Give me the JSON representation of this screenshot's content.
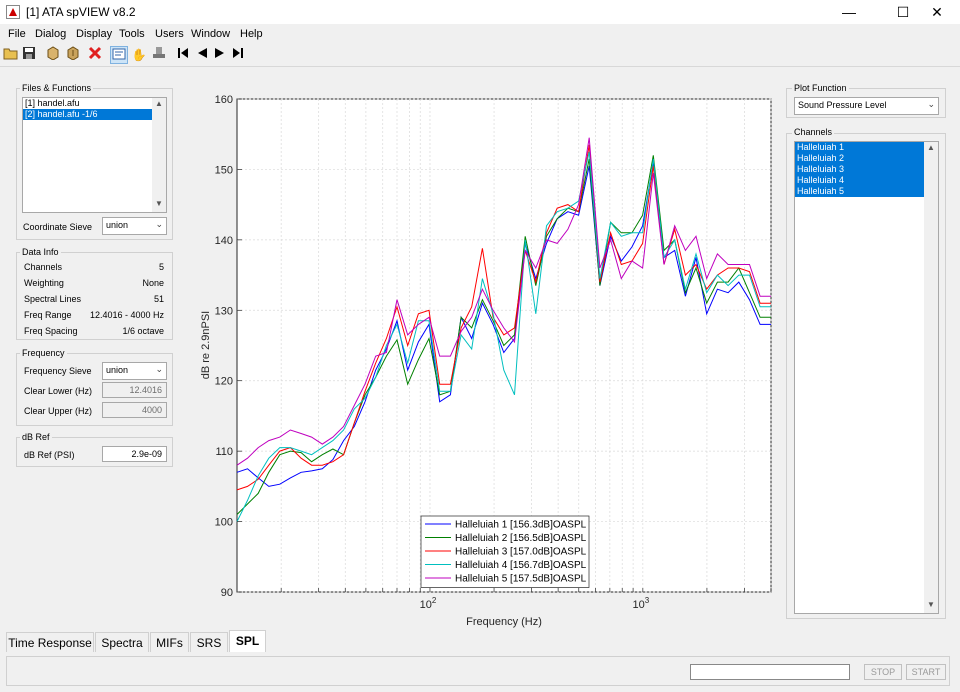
{
  "window": {
    "title": "[1] ATA spVIEW v8.2"
  },
  "menu": [
    "File",
    "Dialog",
    "Display",
    "Tools",
    "Users",
    "Window",
    "Help"
  ],
  "files_functions": {
    "title": "Files & Functions",
    "items": [
      {
        "label": "[1] handel.afu",
        "selected": false
      },
      {
        "label": "[2] handel.afu -1/6",
        "selected": true
      }
    ],
    "coordinate_sieve_label": "Coordinate Sieve",
    "coordinate_sieve_value": "union"
  },
  "data_info": {
    "title": "Data Info",
    "rows": [
      {
        "label": "Channels",
        "value": "5"
      },
      {
        "label": "Weighting",
        "value": "None"
      },
      {
        "label": "Spectral Lines",
        "value": "51"
      },
      {
        "label": "Freq Range",
        "value": "12.4016 - 4000 Hz"
      },
      {
        "label": "Freq Spacing",
        "value": "1/6 octave"
      }
    ]
  },
  "frequency": {
    "title": "Frequency",
    "sieve_label": "Frequency Sieve",
    "sieve_value": "union",
    "clear_lower_label": "Clear Lower (Hz)",
    "clear_lower_value": "12.4016",
    "clear_upper_label": "Clear Upper (Hz)",
    "clear_upper_value": "4000"
  },
  "db_ref": {
    "title": "dB Ref",
    "label": "dB Ref (PSI)",
    "value": "2.9e-09"
  },
  "plot_function": {
    "title": "Plot Function",
    "value": "Sound Pressure Level"
  },
  "channels": {
    "title": "Channels",
    "items": [
      "Halleluiah 1",
      "Halleluiah 2",
      "Halleluiah 3",
      "Halleluiah 4",
      "Halleluiah 5"
    ]
  },
  "tabs": [
    {
      "label": "Time Response",
      "active": false
    },
    {
      "label": "Spectra",
      "active": false
    },
    {
      "label": "MIFs",
      "active": false
    },
    {
      "label": "SRS",
      "active": false
    },
    {
      "label": "SPL",
      "active": true
    }
  ],
  "buttons": {
    "stop": "STOP",
    "start": "START"
  },
  "chart_data": {
    "type": "line",
    "xlabel": "Frequency (Hz)",
    "ylabel": "dB re 2.9nPSI",
    "xscale": "log",
    "xlim": [
      12.4016,
      4000
    ],
    "ylim": [
      90,
      160
    ],
    "yticks": [
      90,
      100,
      110,
      120,
      130,
      140,
      150,
      160
    ],
    "xtick_labels": [
      {
        "value": 100,
        "base": "10",
        "exp": "2"
      },
      {
        "value": 1000,
        "base": "10",
        "exp": "3"
      }
    ],
    "grid": true,
    "legend_position": "bottom-center",
    "x": [
      12.4,
      13.9,
      15.6,
      17.5,
      19.7,
      22.1,
      24.8,
      27.8,
      31.2,
      35.0,
      39.3,
      44.1,
      49.5,
      55.6,
      62.4,
      70.0,
      78.6,
      88.2,
      99.0,
      111.1,
      124.7,
      140.0,
      157.1,
      176.4,
      198.0,
      222.2,
      249.4,
      280.0,
      314.3,
      352.8,
      396.0,
      444.5,
      498.9,
      560.0,
      628.6,
      705.6,
      792.0,
      889.0,
      997.9,
      1120.1,
      1257.3,
      1411.3,
      1584.1,
      1778.1,
      1995.9,
      2240.3,
      2514.7,
      2822.6,
      3168.3,
      3556.3,
      4000.0
    ],
    "series": [
      {
        "name": "Halleluiah 1 [156.3dB]OASPL",
        "color": "#0000ff",
        "values": [
          107.0,
          107.5,
          106.2,
          105.0,
          105.3,
          106.2,
          107.0,
          107.2,
          107.5,
          108.8,
          111.5,
          113.5,
          117.0,
          121.5,
          124.5,
          128.5,
          121.5,
          125.5,
          128.0,
          117.0,
          118.0,
          129.0,
          126.0,
          131.0,
          128.0,
          124.0,
          126.0,
          139.5,
          134.5,
          139.5,
          143.0,
          144.0,
          143.5,
          150.5,
          133.5,
          140.5,
          137.0,
          139.0,
          142.0,
          151.0,
          137.5,
          138.5,
          132.0,
          137.5,
          129.5,
          133.0,
          132.5,
          134.0,
          131.5,
          128.0,
          128.0
        ]
      },
      {
        "name": "Halleluiah 2 [156.5dB]OASPL",
        "color": "#008000",
        "values": [
          101.0,
          102.5,
          104.0,
          107.0,
          109.5,
          110.0,
          109.8,
          108.5,
          109.5,
          110.3,
          109.5,
          114.0,
          118.0,
          120.5,
          123.5,
          125.8,
          119.5,
          123.0,
          126.0,
          118.0,
          118.5,
          129.0,
          127.5,
          131.5,
          128.5,
          125.0,
          126.5,
          140.5,
          133.5,
          140.5,
          143.0,
          144.5,
          144.0,
          151.5,
          133.5,
          142.5,
          141.0,
          141.0,
          143.5,
          152.0,
          138.5,
          140.0,
          132.5,
          136.0,
          131.0,
          134.0,
          134.0,
          136.0,
          132.5,
          129.0,
          129.0
        ]
      },
      {
        "name": "Halleluiah 3 [157.0dB]OASPL",
        "color": "#ff0000",
        "values": [
          104.5,
          105.0,
          106.0,
          108.0,
          110.0,
          110.5,
          109.0,
          108.0,
          108.0,
          108.5,
          109.5,
          114.0,
          118.5,
          122.5,
          126.0,
          130.5,
          125.0,
          129.5,
          130.0,
          119.5,
          119.5,
          127.5,
          130.5,
          138.8,
          129.0,
          126.5,
          127.5,
          138.5,
          134.0,
          141.0,
          144.5,
          145.0,
          144.0,
          153.5,
          134.0,
          141.0,
          136.5,
          137.0,
          139.5,
          150.5,
          136.5,
          141.5,
          135.0,
          136.5,
          133.0,
          135.0,
          136.0,
          136.0,
          135.5,
          131.0,
          131.0
        ]
      },
      {
        "name": "Halleluiah 4 [156.7dB]OASPL",
        "color": "#00bfbf",
        "values": [
          100.0,
          103.0,
          106.5,
          109.0,
          110.5,
          110.5,
          110.0,
          109.5,
          110.5,
          111.5,
          113.0,
          116.0,
          117.5,
          120.5,
          125.0,
          128.0,
          122.5,
          128.5,
          128.5,
          118.5,
          118.5,
          126.5,
          124.5,
          134.5,
          129.5,
          121.5,
          118.0,
          140.0,
          129.5,
          142.0,
          144.0,
          144.5,
          145.5,
          152.5,
          134.5,
          142.5,
          140.5,
          141.0,
          141.0,
          151.5,
          137.5,
          140.0,
          133.0,
          138.0,
          132.5,
          135.0,
          133.5,
          135.0,
          135.0,
          130.5,
          130.5
        ]
      },
      {
        "name": "Halleluiah 5 [157.5dB]OASPL",
        "color": "#bf00bf",
        "values": [
          108.0,
          109.0,
          110.5,
          111.5,
          112.0,
          113.0,
          112.5,
          112.0,
          111.0,
          112.0,
          113.5,
          116.5,
          119.5,
          123.5,
          124.0,
          131.5,
          126.5,
          128.0,
          129.0,
          123.5,
          123.5,
          127.0,
          129.0,
          133.0,
          130.0,
          127.5,
          125.5,
          138.5,
          136.0,
          140.0,
          139.5,
          141.5,
          145.0,
          154.5,
          136.0,
          140.0,
          134.5,
          137.0,
          136.0,
          149.5,
          136.5,
          142.0,
          138.5,
          140.5,
          134.5,
          138.0,
          136.5,
          136.5,
          136.5,
          132.0,
          132.0
        ]
      }
    ]
  }
}
